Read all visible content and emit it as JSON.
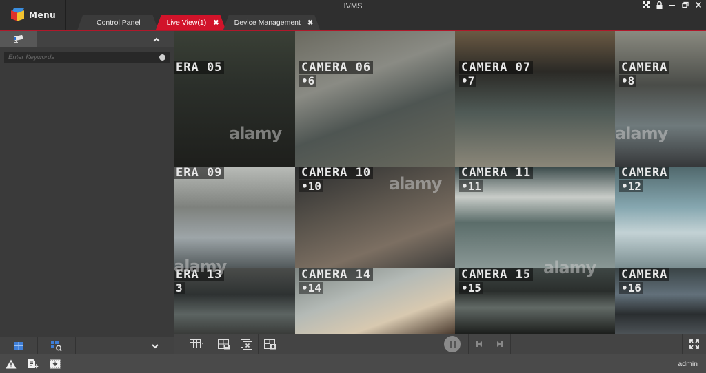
{
  "app": {
    "title": "IVMS",
    "menu_label": "Menu"
  },
  "window_controls": [
    {
      "name": "layout-icon",
      "glyph": "⊞"
    },
    {
      "name": "lock-icon",
      "glyph": "🔒"
    },
    {
      "name": "minimize-icon",
      "glyph": "–"
    },
    {
      "name": "restore-icon",
      "glyph": "❐"
    },
    {
      "name": "close-icon",
      "glyph": "✕"
    }
  ],
  "tabs": [
    {
      "label": "Control Panel",
      "active": false,
      "closable": false
    },
    {
      "label": "Live View(1)",
      "active": true,
      "closable": true
    },
    {
      "label": "Device Management",
      "active": false,
      "closable": true
    }
  ],
  "tab_close_glyph": "✖",
  "sidebar": {
    "search_placeholder": "Enter Keywords",
    "search_value": "",
    "collapse_glyph": "⌃",
    "expand_glyph": "⌄"
  },
  "video": {
    "watermark": "alamy",
    "cameras": [
      {
        "label": "ERA 05",
        "num": "",
        "partial": true
      },
      {
        "label": "CAMERA 06",
        "num": "•6"
      },
      {
        "label": "CAMERA 07",
        "num": "•7"
      },
      {
        "label": "CAMERA",
        "num": "•8"
      },
      {
        "label": "ERA 09",
        "num": "",
        "partial": true
      },
      {
        "label": "CAMERA 10",
        "num": "•10"
      },
      {
        "label": "CAMERA 11",
        "num": "•11"
      },
      {
        "label": "CAMERA",
        "num": "•12"
      },
      {
        "label": "ERA 13",
        "num": "3",
        "partial": true
      },
      {
        "label": "CAMERA 14",
        "num": "•14"
      },
      {
        "label": "CAMERA 15",
        "num": "•15"
      },
      {
        "label": "CAMERA",
        "num": "•16"
      }
    ]
  },
  "status": {
    "user": "admin"
  },
  "colors": {
    "accent": "#d1132a",
    "background": "#3a3a3a",
    "titlebar": "#2f2f2f"
  }
}
